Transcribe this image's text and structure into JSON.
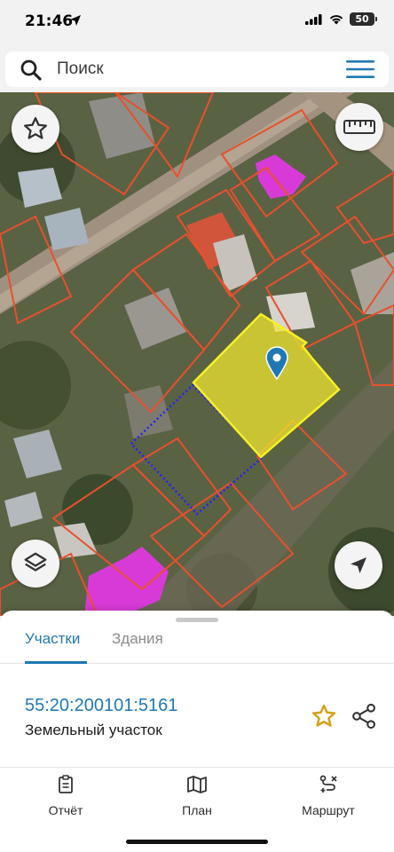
{
  "status_bar": {
    "time": "21:46",
    "battery": "50"
  },
  "search": {
    "placeholder": "Поиск"
  },
  "map": {
    "selected_parcel_color": "#f2ea2e",
    "parcel_border_color": "#e8502c",
    "building_color": "#d83ad8",
    "dotted_boundary_color": "#2222ff"
  },
  "sheet": {
    "tabs": [
      {
        "label": "Участки",
        "active": true
      },
      {
        "label": "Здания",
        "active": false
      }
    ],
    "parcel": {
      "cadastral_number": "55:20:200101:5161",
      "type": "Земельный участок"
    }
  },
  "bottom_nav": {
    "items": [
      {
        "label": "Отчёт",
        "icon": "report-icon"
      },
      {
        "label": "План",
        "icon": "map-plan-icon"
      },
      {
        "label": "Маршрут",
        "icon": "route-icon"
      }
    ]
  },
  "colors": {
    "accent": "#1f78b4",
    "favorite_star": "#d4a017"
  }
}
